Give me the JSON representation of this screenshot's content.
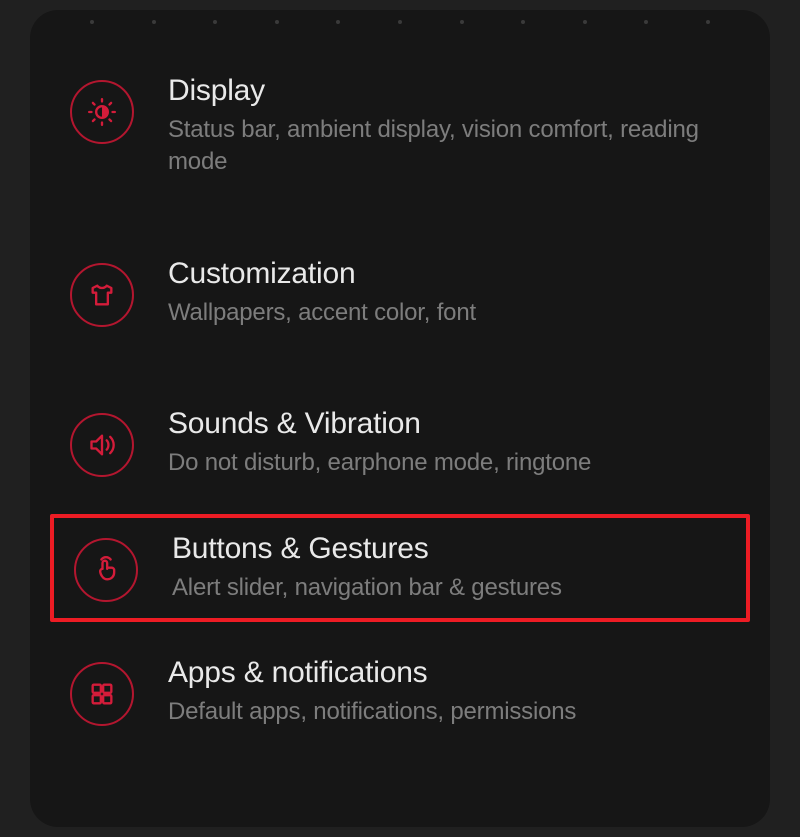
{
  "settings": [
    {
      "icon": "brightness-icon",
      "title": "Display",
      "subtitle": "Status bar, ambient display, vision comfort, reading mode"
    },
    {
      "icon": "tshirt-icon",
      "title": "Customization",
      "subtitle": "Wallpapers, accent color, font"
    },
    {
      "icon": "sound-icon",
      "title": "Sounds & Vibration",
      "subtitle": "Do not disturb, earphone mode, ringtone"
    },
    {
      "icon": "touch-icon",
      "title": "Buttons & Gestures",
      "subtitle": "Alert slider, navigation bar & gestures",
      "highlighted": true
    },
    {
      "icon": "apps-icon",
      "title": "Apps & notifications",
      "subtitle": "Default apps, notifications, permissions"
    }
  ]
}
